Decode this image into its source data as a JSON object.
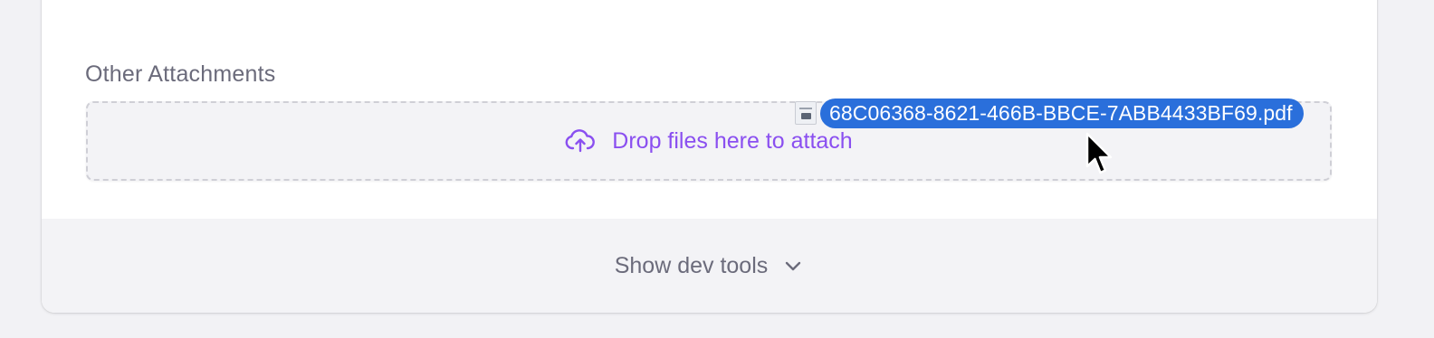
{
  "attachments": {
    "label": "Other Attachments",
    "dropzone_text": "Drop files here to attach",
    "dropzone_icon": "cloud-upload-icon",
    "accent_color": "#8a4ff0"
  },
  "footer": {
    "toggle_label": "Show dev tools",
    "toggle_icon": "chevron-down-icon"
  },
  "drag": {
    "file_name": "68C06368-8621-466B-BBCE-7ABB4433BF69.pdf",
    "file_icon": "pdf-file-icon",
    "highlight_color": "#2a6fdb"
  }
}
